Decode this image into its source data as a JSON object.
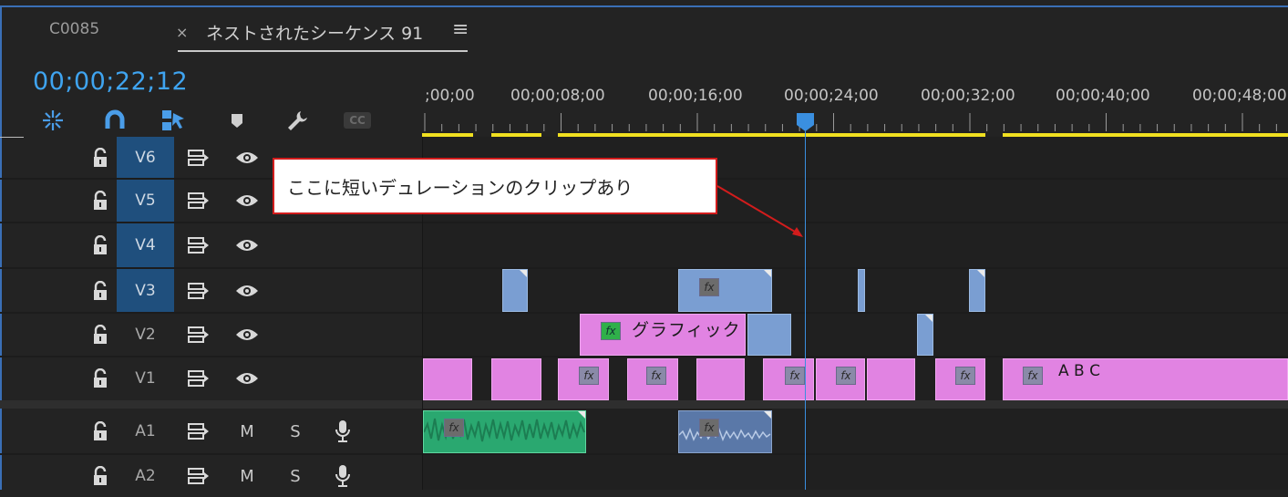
{
  "tabs": [
    {
      "label": "C0085"
    },
    {
      "label": "ネストされたシーケンス 91",
      "close": "×",
      "menu": "≡"
    }
  ],
  "timecode": "00;00;22;12",
  "toolbar": {
    "icons": [
      "snap-icon",
      "magnet-icon",
      "linked-selection-icon",
      "marker-icon",
      "wrench-icon",
      "captions-icon"
    ],
    "captions_label": "CC"
  },
  "ruler": {
    "labels": [
      ";00;00",
      "00;00;08;00",
      "00;00;16;00",
      "00;00;24;00",
      "00;00;32;00",
      "00;00;40;00",
      "00;00;48;00"
    ]
  },
  "tracks": {
    "video": [
      {
        "name": "V6",
        "targeted": true
      },
      {
        "name": "V5",
        "targeted": true
      },
      {
        "name": "V4",
        "targeted": true
      },
      {
        "name": "V3",
        "targeted": true
      },
      {
        "name": "V2",
        "targeted": false
      },
      {
        "name": "V1",
        "targeted": false
      }
    ],
    "audio": [
      {
        "name": "A1",
        "mute": "M",
        "solo": "S"
      },
      {
        "name": "A2",
        "mute": "M",
        "solo": "S"
      }
    ]
  },
  "clips": {
    "graphic_label": "グラフィック",
    "abc_label": "A B C",
    "fx": "fx"
  },
  "callout": {
    "text": "ここに短いデュレーションのクリップあり"
  },
  "colors": {
    "timecode": "#3fa4f0",
    "playhead": "#3a8fe0",
    "work_area": "#f0e020",
    "video_clip_blue": "#7a9ed2",
    "video_clip_pink": "#e183e2",
    "audio_clip_green": "#2fb87a",
    "audio_clip_blue": "#5a78a8",
    "callout_border": "#d21c1c"
  }
}
